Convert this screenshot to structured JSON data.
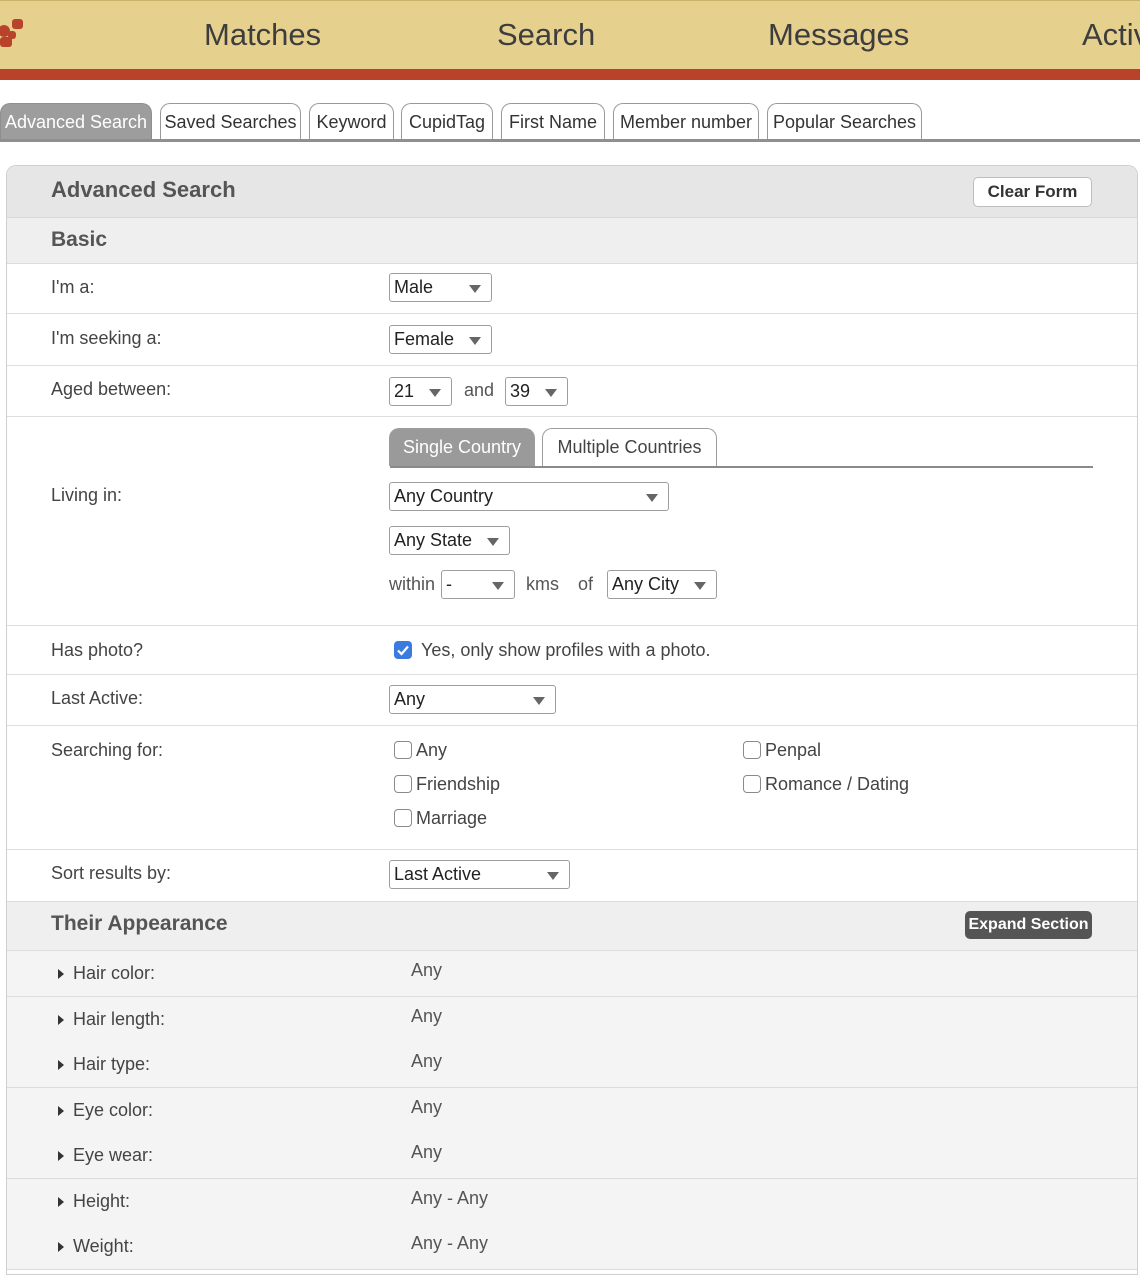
{
  "colors": {
    "nav_bg": "#e6d08e",
    "nav_stripe": "#b8432a",
    "checkbox_checked": "#3b7be0"
  },
  "topnav": {
    "logo_icon": "people-icon",
    "items": [
      "Matches",
      "Search",
      "Messages",
      "Activ"
    ]
  },
  "tabs": [
    "Advanced Search",
    "Saved Searches",
    "Keyword",
    "CupidTag",
    "First Name",
    "Member number",
    "Popular Searches"
  ],
  "panel": {
    "title": "Advanced Search",
    "clear_button": "Clear Form"
  },
  "basic": {
    "section_title": "Basic",
    "gender": {
      "label": "I'm a:",
      "value": "Male"
    },
    "seeking": {
      "label": "I'm seeking a:",
      "value": "Female"
    },
    "age": {
      "label": "Aged between:",
      "min": "21",
      "connector": "and",
      "max": "39"
    },
    "location": {
      "label": "Living in:",
      "tabs": [
        "Single Country",
        "Multiple Countries"
      ],
      "country": "Any Country",
      "state": "Any State",
      "within_label": "within",
      "distance": "-",
      "unit": "kms",
      "of_label": "of",
      "city": "Any City"
    },
    "photo": {
      "label": "Has photo?",
      "checked": true,
      "option": "Yes, only show profiles with a photo."
    },
    "last_active": {
      "label": "Last Active:",
      "value": "Any"
    },
    "searching_for": {
      "label": "Searching for:",
      "options": [
        "Any",
        "Penpal",
        "Friendship",
        "Romance / Dating",
        "Marriage"
      ]
    },
    "sort": {
      "label": "Sort results by:",
      "value": "Last Active"
    }
  },
  "appearance": {
    "section_title": "Their Appearance",
    "expand_button": "Expand Section",
    "rows": [
      {
        "label": "Hair color:",
        "value": "Any"
      },
      {
        "label": "Hair length:",
        "value": "Any"
      },
      {
        "label": "Hair type:",
        "value": "Any"
      },
      {
        "label": "Eye color:",
        "value": "Any"
      },
      {
        "label": "Eye wear:",
        "value": "Any"
      },
      {
        "label": "Height:",
        "value": "Any - Any"
      },
      {
        "label": "Weight:",
        "value": "Any - Any"
      }
    ]
  }
}
